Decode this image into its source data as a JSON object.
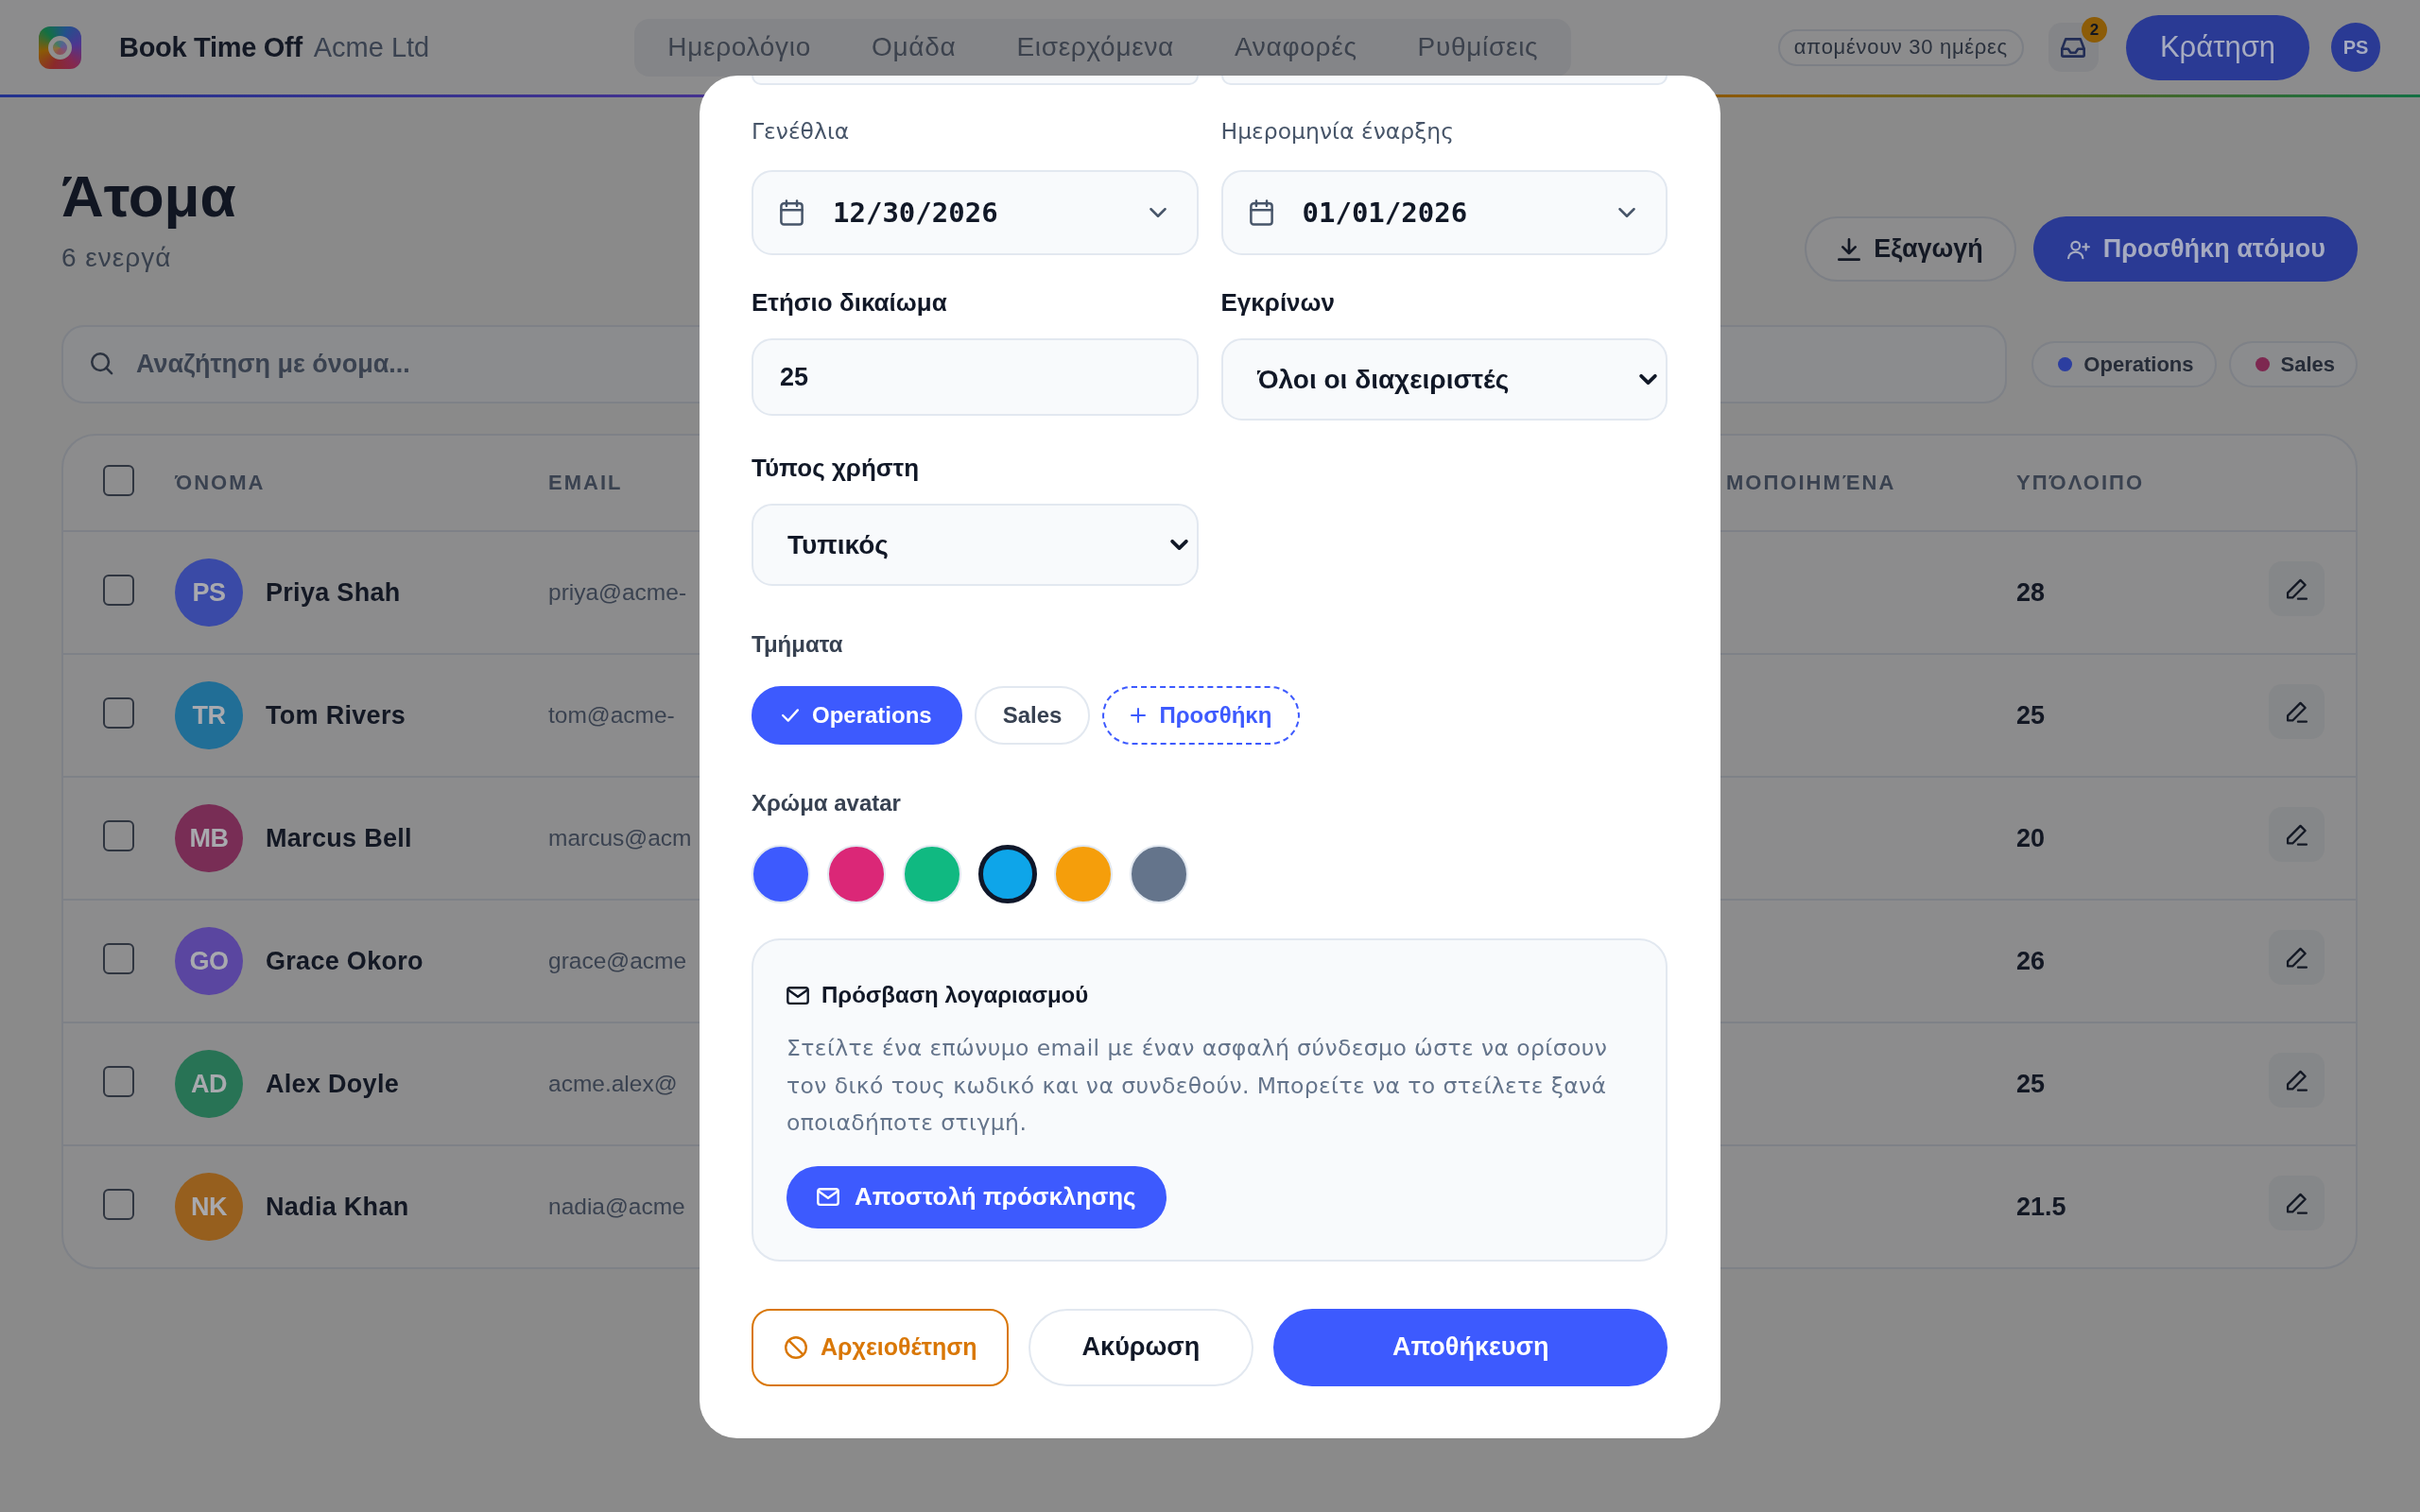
{
  "header": {
    "brand": {
      "name": "Book Time Off",
      "org": "Acme Ltd"
    },
    "nav": [
      {
        "label": "Ημερολόγιο",
        "selected": false
      },
      {
        "label": "Ομάδα",
        "selected": false
      },
      {
        "label": "Εισερχόμενα",
        "selected": false
      },
      {
        "label": "Αναφορές",
        "selected": false
      },
      {
        "label": "Ρυθμίσεις",
        "selected": false
      }
    ],
    "days_left": "απομένουν 30 ημέρες",
    "inbox_badge": "2",
    "book_button": "Κράτηση",
    "user_initials": "PS"
  },
  "page": {
    "title": "Άτομα",
    "subtitle": "6 ενεργά",
    "actions": [
      {
        "kind": "export",
        "label": "Εξαγωγή"
      },
      {
        "kind": "add",
        "label": "Προσθήκη ατόμου"
      }
    ],
    "search": {
      "placeholder": "Αναζήτηση με όνομα..."
    },
    "filters": [
      {
        "label": "Operations",
        "color": "#2c3ea0"
      },
      {
        "label": "Sales",
        "color": "#7d2850"
      }
    ],
    "table": {
      "all_checked": false,
      "columns": [
        {
          "label": "ΌΝΟΜΑ"
        },
        {
          "label": "EMAIL"
        },
        {
          "label": "ΜΟΠΟΙΗΜΈΝΑ"
        },
        {
          "label": "ΥΠΌΛΟΙΠΟ"
        }
      ],
      "rows": [
        {
          "checked": false,
          "initials": "PS",
          "color": "#3a4aa6",
          "name": "Priya Shah",
          "email": "priya@acme-",
          "balance": "28"
        },
        {
          "checked": false,
          "initials": "TR",
          "color": "#216e96",
          "name": "Tom Rivers",
          "email": "tom@acme-",
          "balance": "25"
        },
        {
          "checked": false,
          "initials": "MB",
          "color": "#782d55",
          "name": "Marcus Bell",
          "email": "marcus@acm",
          "balance": "20"
        },
        {
          "checked": false,
          "initials": "GO",
          "color": "#5a46a0",
          "name": "Grace Okoro",
          "email": "grace@acme",
          "balance": "26"
        },
        {
          "checked": false,
          "initials": "AD",
          "color": "#287355",
          "name": "Alex Doyle",
          "email": "acme.alex@",
          "balance": "25"
        },
        {
          "checked": false,
          "initials": "NK",
          "color": "#965f1e",
          "name": "Nadia Khan",
          "email": "nadia@acme",
          "balance": "21.5"
        }
      ]
    }
  },
  "modal": {
    "fields": [
      {
        "kind": "date",
        "label": "Γενέθλια",
        "value": "12/30/2026"
      },
      {
        "kind": "date",
        "label": "Ημερομηνία έναρξης",
        "value": "01/01/2026"
      },
      {
        "kind": "number",
        "label": "Ετήσιο δικαίωμα",
        "value": "25"
      },
      {
        "kind": "select",
        "label": "Εγκρίνων",
        "value": "Όλοι οι διαχειριστές"
      },
      {
        "kind": "select",
        "label": "Τύπος χρήστη",
        "value": "Τυπικός"
      }
    ],
    "departments": {
      "label": "Τμήματα",
      "items": [
        {
          "label": "Operations",
          "selected": true
        },
        {
          "label": "Sales",
          "selected": false
        }
      ],
      "add_label": "Προσθήκη"
    },
    "avatar_color": {
      "label": "Χρώμα avatar",
      "options": [
        {
          "color": "#3d5afe",
          "selected": false
        },
        {
          "color": "#db2777",
          "selected": false
        },
        {
          "color": "#10b981",
          "selected": false
        },
        {
          "color": "#0ea5e9",
          "selected": true
        },
        {
          "color": "#f59e0b",
          "selected": false
        },
        {
          "color": "#64748b",
          "selected": false
        }
      ]
    },
    "account_access": {
      "title": "Πρόσβαση λογαριασμού",
      "text": "Στείλτε ένα επώνυμο email με έναν ασφαλή σύνδεσμο ώστε να ορίσουν τον δικό τους κωδικό και να συνδεθούν. Μπορείτε να το στείλετε ξανά οποιαδήποτε στιγμή.",
      "button": "Αποστολή πρόσκλησης"
    },
    "buttons": [
      {
        "kind": "archive",
        "label": "Αρχειοθέτηση"
      },
      {
        "kind": "cancel",
        "label": "Ακύρωση"
      },
      {
        "kind": "save",
        "label": "Αποθήκευση"
      }
    ]
  }
}
